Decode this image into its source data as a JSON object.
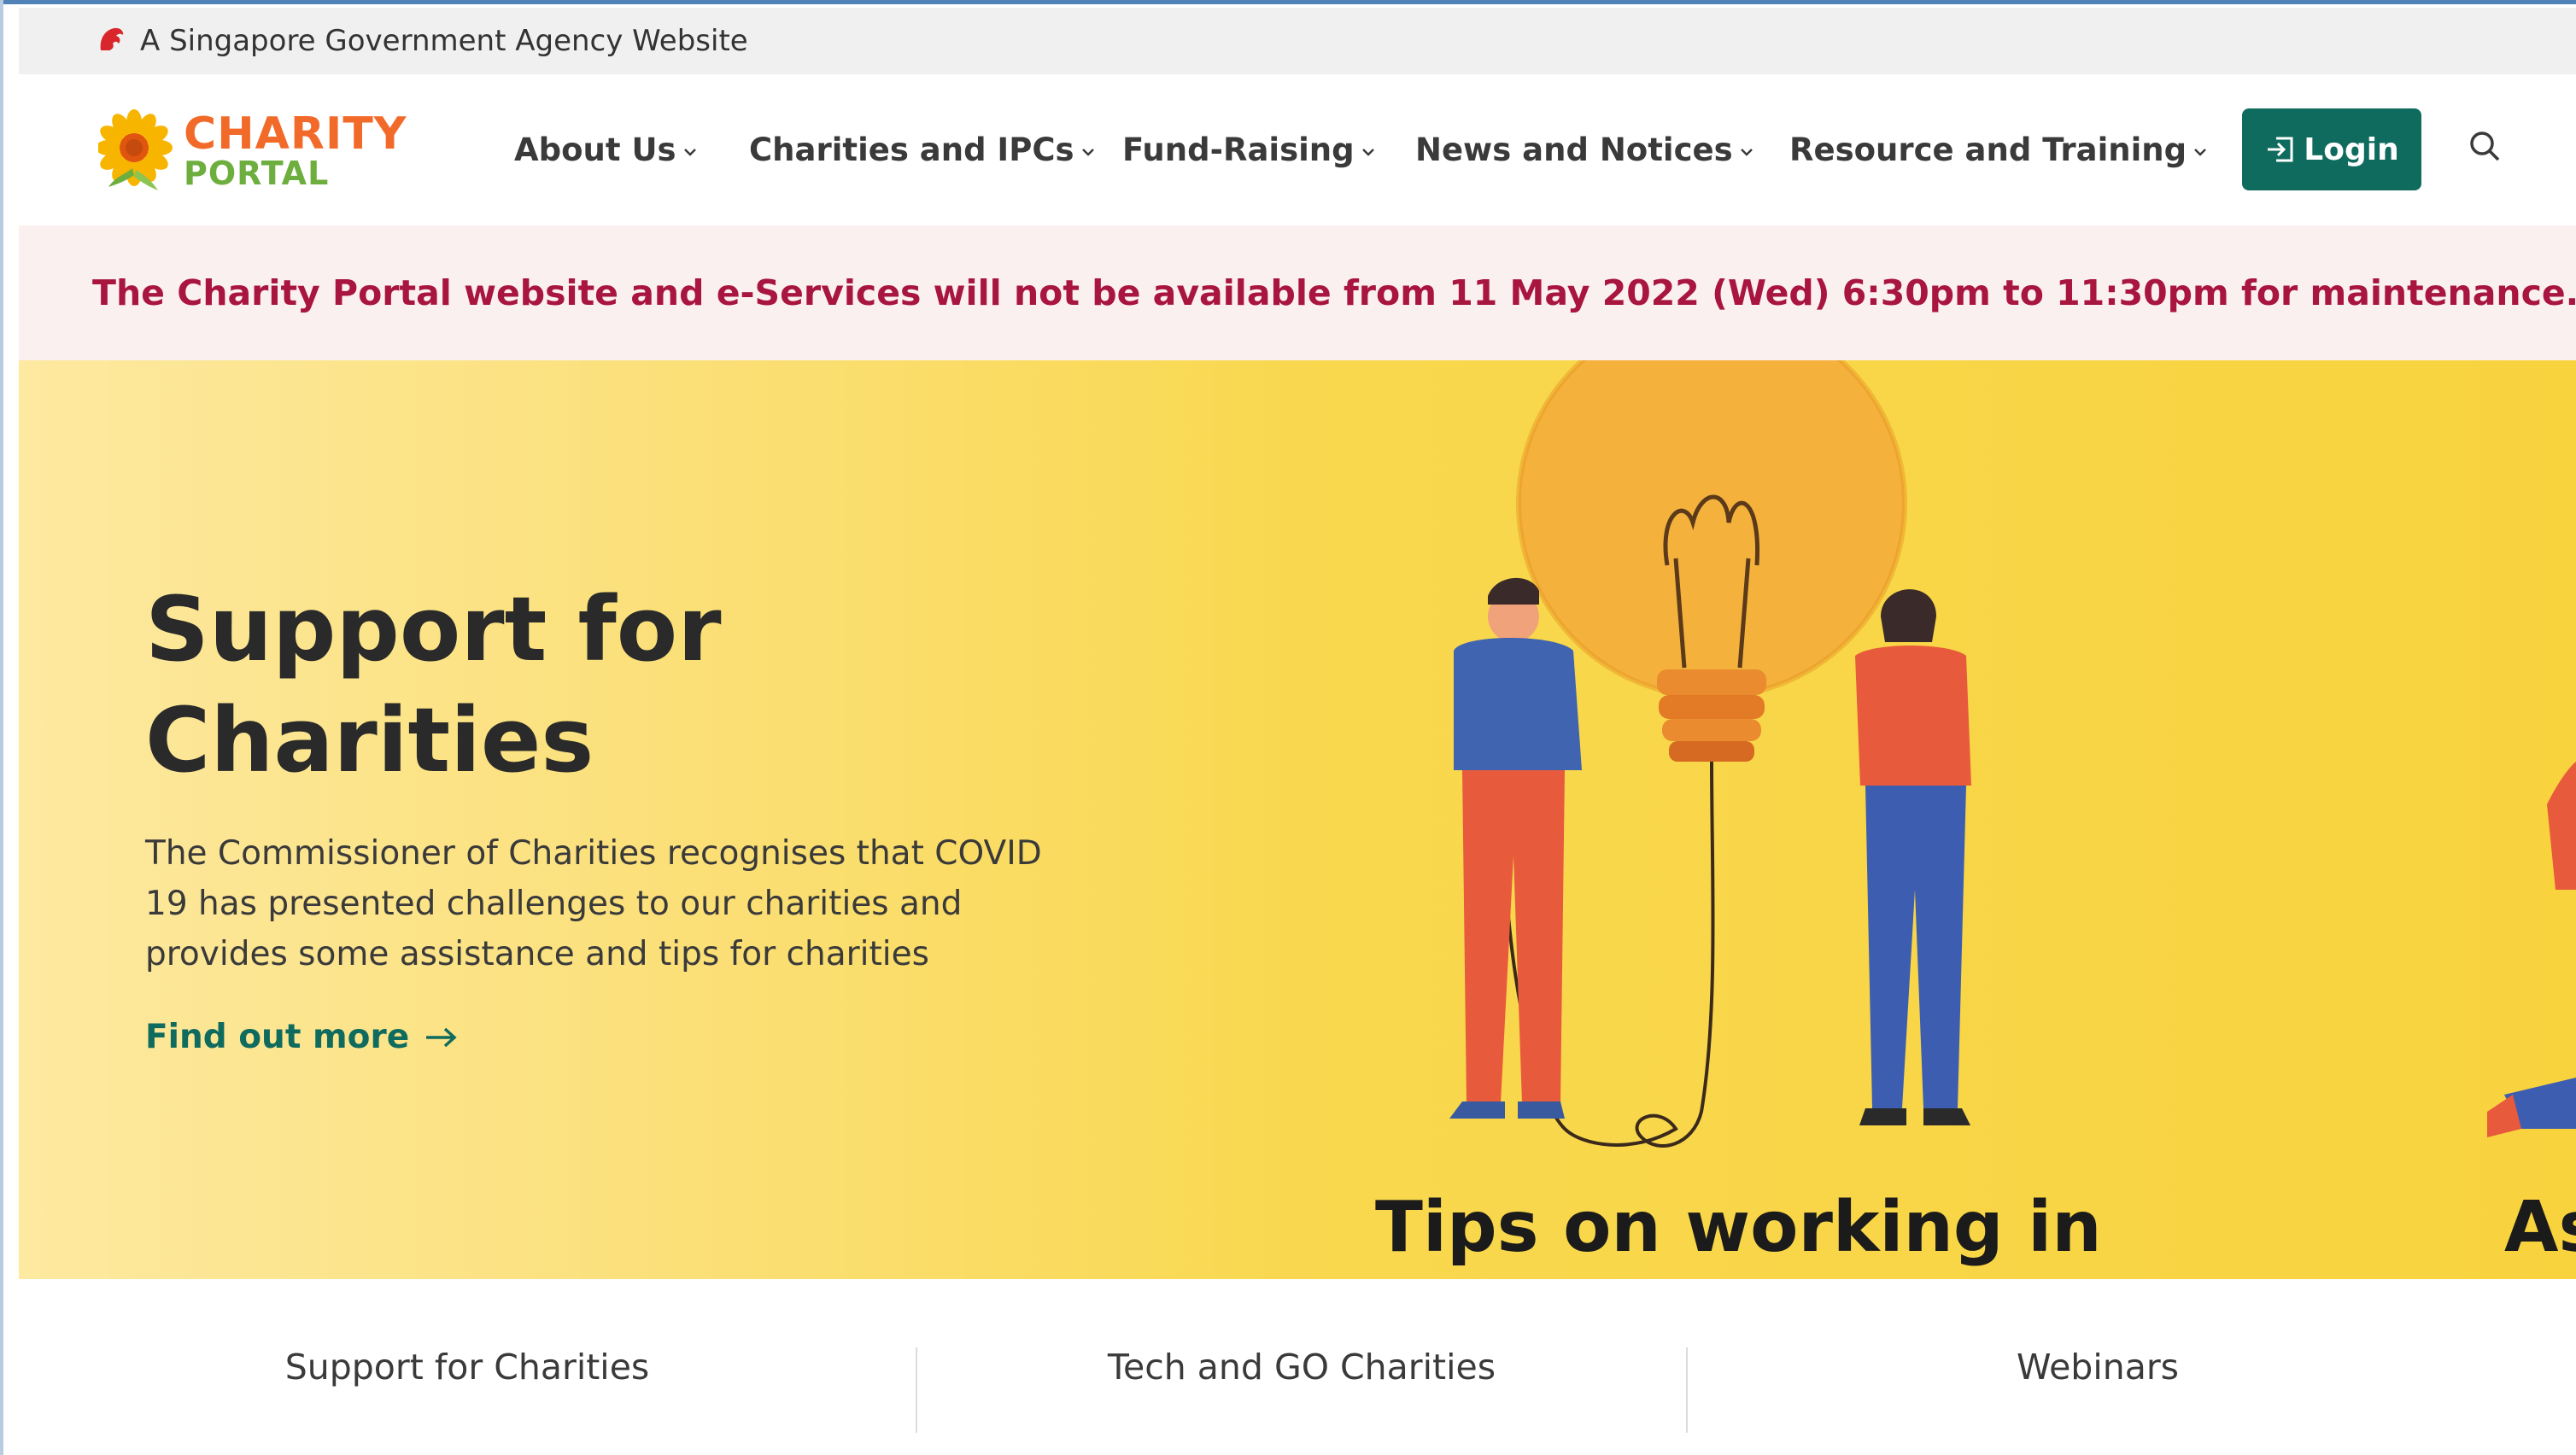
{
  "masthead": {
    "text": "A Singapore Government Agency Website",
    "icon": "lion-head-icon"
  },
  "brand": {
    "line1": "CHARITY",
    "line2": "PORTAL",
    "colors": {
      "charity": "#f26a2a",
      "portal": "#6dae3e"
    }
  },
  "nav": {
    "items": [
      {
        "label": "About Us"
      },
      {
        "label": "Charities and IPCs"
      },
      {
        "label": "Fund-Raising"
      },
      {
        "label": "News and Notices"
      },
      {
        "label": "Resource and Training"
      }
    ],
    "login_label": "Login",
    "search_icon": "search-icon"
  },
  "notice": {
    "text": "The Charity Portal website and e-Services will not be available from 11 May 2022 (Wed) 6:30pm to 11:30pm for maintenance."
  },
  "hero": {
    "title_line1": "Support for",
    "title_line2": "Charities",
    "description": "The Commissioner of Charities recognises that COVID 19 has presented challenges to our charities and provides some assistance and tips for charities",
    "link_label": "Find out more",
    "slide_caption": "Tips on working in",
    "next_caption": "As"
  },
  "tabs": [
    {
      "label": "Support for Charities"
    },
    {
      "label": "Tech and GO Charities"
    },
    {
      "label": "Webinars"
    }
  ],
  "colors": {
    "accent": "#0f6b5e",
    "notice_text": "#a8153f",
    "notice_bg": "#fbf0f0",
    "hero_bg": "#f9d84f"
  }
}
